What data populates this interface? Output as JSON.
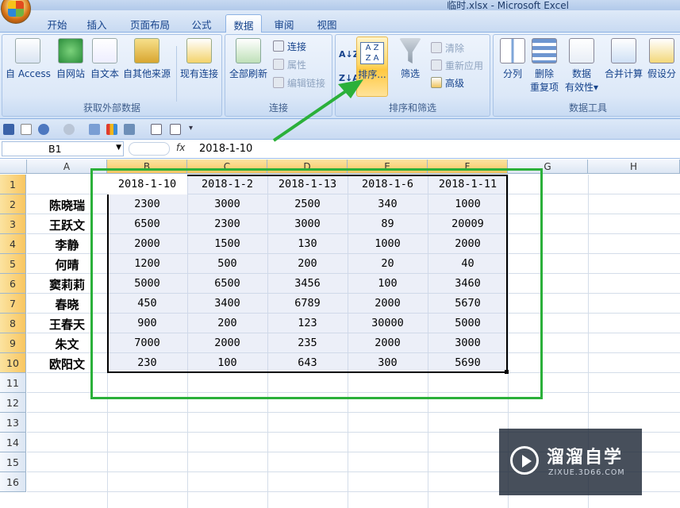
{
  "window": {
    "title": "临时.xlsx - Microsoft Excel"
  },
  "tabs": [
    "开始",
    "插入",
    "页面布局",
    "公式",
    "数据",
    "审阅",
    "视图"
  ],
  "active_tab": "数据",
  "ribbon": {
    "groups": {
      "external": {
        "label": "获取外部数据",
        "buttons": [
          "自 Access",
          "自网站",
          "自文本",
          "自其他来源",
          "现有连接"
        ]
      },
      "connections": {
        "label": "连接",
        "refresh": "全部刷新",
        "small": [
          "连接",
          "属性",
          "编辑链接"
        ]
      },
      "sortfilter": {
        "label": "排序和筛选",
        "sort": "排序...",
        "filter": "筛选",
        "small": [
          "清除",
          "重新应用",
          "高级"
        ]
      },
      "datatools": {
        "label": "数据工具",
        "buttons": [
          "分列",
          "删除",
          "重复项",
          "数据",
          "有效性",
          "合并计算",
          "假设分"
        ]
      }
    }
  },
  "formula_bar": {
    "name_box": "B1",
    "fx": "fx",
    "value": "2018-1-10"
  },
  "columns": [
    "A",
    "B",
    "C",
    "D",
    "E",
    "F",
    "G",
    "H"
  ],
  "rows": [
    "1",
    "2",
    "3",
    "4",
    "5",
    "6",
    "7",
    "8",
    "9",
    "10",
    "11",
    "12",
    "13",
    "14",
    "15",
    "16"
  ],
  "table": {
    "headers": [
      "2018-1-10",
      "2018-1-2",
      "2018-1-13",
      "2018-1-6",
      "2018-1-11"
    ],
    "names": [
      "陈晓瑞",
      "王跃文",
      "李静",
      "何晴",
      "窦莉莉",
      "春晓",
      "王春天",
      "朱文",
      "欧阳文"
    ],
    "values": [
      [
        "2300",
        "3000",
        "2500",
        "340",
        "1000"
      ],
      [
        "6500",
        "2300",
        "3000",
        "89",
        "20009"
      ],
      [
        "2000",
        "1500",
        "130",
        "1000",
        "2000"
      ],
      [
        "1200",
        "500",
        "200",
        "20",
        "40"
      ],
      [
        "5000",
        "6500",
        "3456",
        "100",
        "3460"
      ],
      [
        "450",
        "3400",
        "6789",
        "2000",
        "5670"
      ],
      [
        "900",
        "200",
        "123",
        "30000",
        "5000"
      ],
      [
        "7000",
        "2000",
        "235",
        "2000",
        "3000"
      ],
      [
        "230",
        "100",
        "643",
        "300",
        "5690"
      ]
    ]
  },
  "watermark": {
    "title": "溜溜自学",
    "url": "ZIXUE.3D66.COM"
  },
  "colors": {
    "annotation": "#2bb03a",
    "ribbon": "#dce8f8",
    "selection": "#000000"
  }
}
